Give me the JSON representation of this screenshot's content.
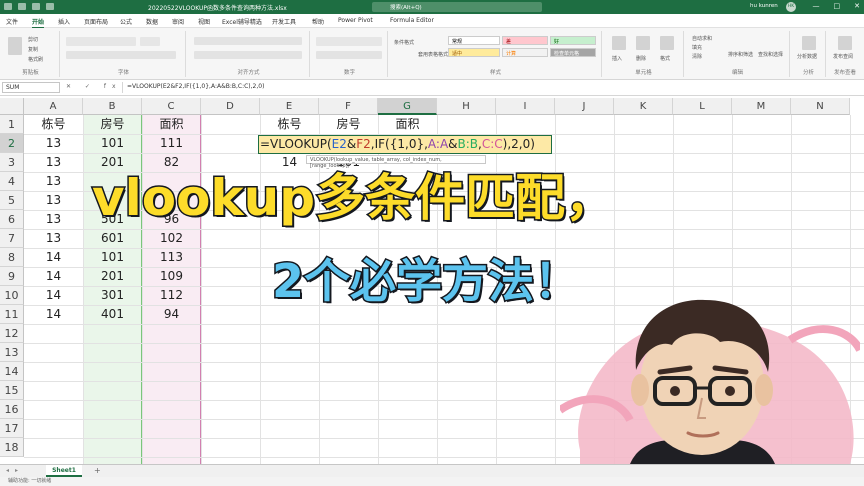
{
  "titlebar": {
    "filename": "20220522VLOOKUP函数多条件查询两种方法.xlsx",
    "search_placeholder": "搜索(Alt+Q)",
    "user": "hu kunren",
    "user_initials": "HK",
    "min": "—",
    "max": "□",
    "close": "✕"
  },
  "menu": [
    "文件",
    "开始",
    "插入",
    "页面布局",
    "公式",
    "数据",
    "审阅",
    "视图",
    "Excel辅导精选",
    "开发工具",
    "帮助",
    "Power Pivot",
    "Formula Editor"
  ],
  "ribbon": {
    "clipboard": {
      "label": "剪贴板",
      "cut": "剪切",
      "copy": "复制",
      "format_painter": "格式刷"
    },
    "font": {
      "label": "字体"
    },
    "alignment": {
      "label": "对齐方式"
    },
    "number": {
      "label": "数字"
    },
    "styles": {
      "label": "样式",
      "normal": "常规",
      "bad": "差",
      "good": "好",
      "neutral": "适中",
      "calculation": "计算",
      "check_cell": "检查单元格",
      "conditional": "条件格式",
      "table_format": "套用表格格式"
    },
    "cells": {
      "label": "单元格",
      "insert": "插入",
      "delete": "删除",
      "format": "格式"
    },
    "editing": {
      "label": "编辑",
      "autosum": "自动求和",
      "fill": "填充",
      "clear": "清除",
      "sort": "排序和筛选",
      "find": "查找和选择"
    },
    "analysis": {
      "label": "分析",
      "analyze": "分析数据"
    },
    "publish": {
      "label": "发布查看",
      "btn": "发布查阅"
    }
  },
  "formula_bar": {
    "name_box": "SUM",
    "fx": "✕ ✓ fx",
    "formula": "=VLOOKUP(E2&F2,IF({1,0},A:A&B:B,C:C),2,0)"
  },
  "columns": [
    "A",
    "B",
    "C",
    "D",
    "E",
    "F",
    "G",
    "H",
    "I",
    "J",
    "K",
    "L",
    "M",
    "N"
  ],
  "rows": [
    "1",
    "2",
    "3",
    "4",
    "5",
    "6",
    "7",
    "8",
    "9",
    "10",
    "11",
    "12",
    "13",
    "14",
    "15",
    "16",
    "17",
    "18"
  ],
  "table": {
    "headers": [
      "栋号",
      "房号",
      "面积"
    ],
    "rows": [
      [
        "13",
        "101",
        "111"
      ],
      [
        "13",
        "201",
        "82"
      ],
      [
        "13",
        "",
        ""
      ],
      [
        "13",
        "",
        ""
      ],
      [
        "13",
        "501",
        "96"
      ],
      [
        "13",
        "601",
        "102"
      ],
      [
        "14",
        "101",
        "113"
      ],
      [
        "14",
        "201",
        "109"
      ],
      [
        "14",
        "301",
        "112"
      ],
      [
        "14",
        "401",
        "94"
      ]
    ]
  },
  "lookup": {
    "headers": [
      "栋号",
      "房号",
      "面积"
    ],
    "values": [
      "14",
      "101",
      ""
    ]
  },
  "edit_formula_parts": [
    "=VLOOKUP(",
    "E2",
    "&",
    "F2",
    ",IF({1,0},",
    "A:A",
    "&",
    "B:B",
    ",",
    "C:C",
    "),2,0)"
  ],
  "tooltip": "VLOOKUP(lookup_value, table_array, col_index_num, [range_lookup])",
  "overlay": {
    "line1": "vlookup多条件匹配，",
    "line2": "2个必学方法！"
  },
  "sheet_tab": "Sheet1",
  "add_sheet": "+",
  "status": "辅助功能: 一切就绪",
  "colors": {
    "excel_green": "#1e6e42",
    "title_yellow": "#fddc2a",
    "title_blue": "#5cc3ee",
    "band_green": "#eaf6ea",
    "band_pink": "#f9ecf3"
  }
}
